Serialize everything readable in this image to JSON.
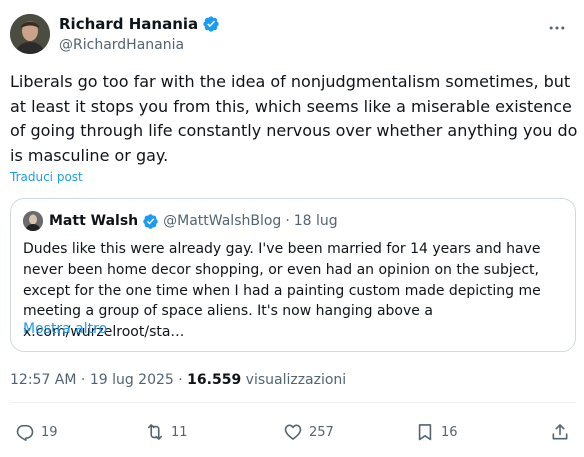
{
  "author": {
    "name": "Richard Hanania",
    "handle": "@RichardHanania"
  },
  "tweet": {
    "text": "Liberals go too far with the idea of nonjudgmentalism sometimes, but at least it stops you from this, which seems like a miserable existence of going through life constantly nervous over whether anything you do is masculine or gay.",
    "translate_label": "Traduci post"
  },
  "quote": {
    "name": "Matt Walsh",
    "handle": "@MattWalshBlog",
    "separator": "·",
    "date": "18 lug",
    "text": "Dudes like this were already gay. I've been married for 14 years and have never been home decor shopping, or even had an opinion on the subject, except for the one time when I had a painting custom made depicting me meeting a group of space aliens. It's now hanging above a x.com/wurzelroot/sta…",
    "more_label": "Mostra altro"
  },
  "meta": {
    "time": "12:57 AM",
    "separator": "·",
    "date": "19 lug 2025",
    "views_count": "16.559",
    "views_label": "visualizzazioni"
  },
  "actions": {
    "replies": "19",
    "reposts": "11",
    "likes": "257",
    "bookmarks": "16"
  },
  "colors": {
    "accent": "#1d9bf0",
    "secondary_text": "#536471",
    "primary_text": "#0f1419",
    "border": "#cfd9de"
  },
  "icons": {
    "verified": "verified-badge-icon",
    "more": "more-dots-icon",
    "reply": "reply-icon",
    "repost": "repost-icon",
    "like": "heart-icon",
    "bookmark": "bookmark-icon",
    "share": "share-icon"
  }
}
